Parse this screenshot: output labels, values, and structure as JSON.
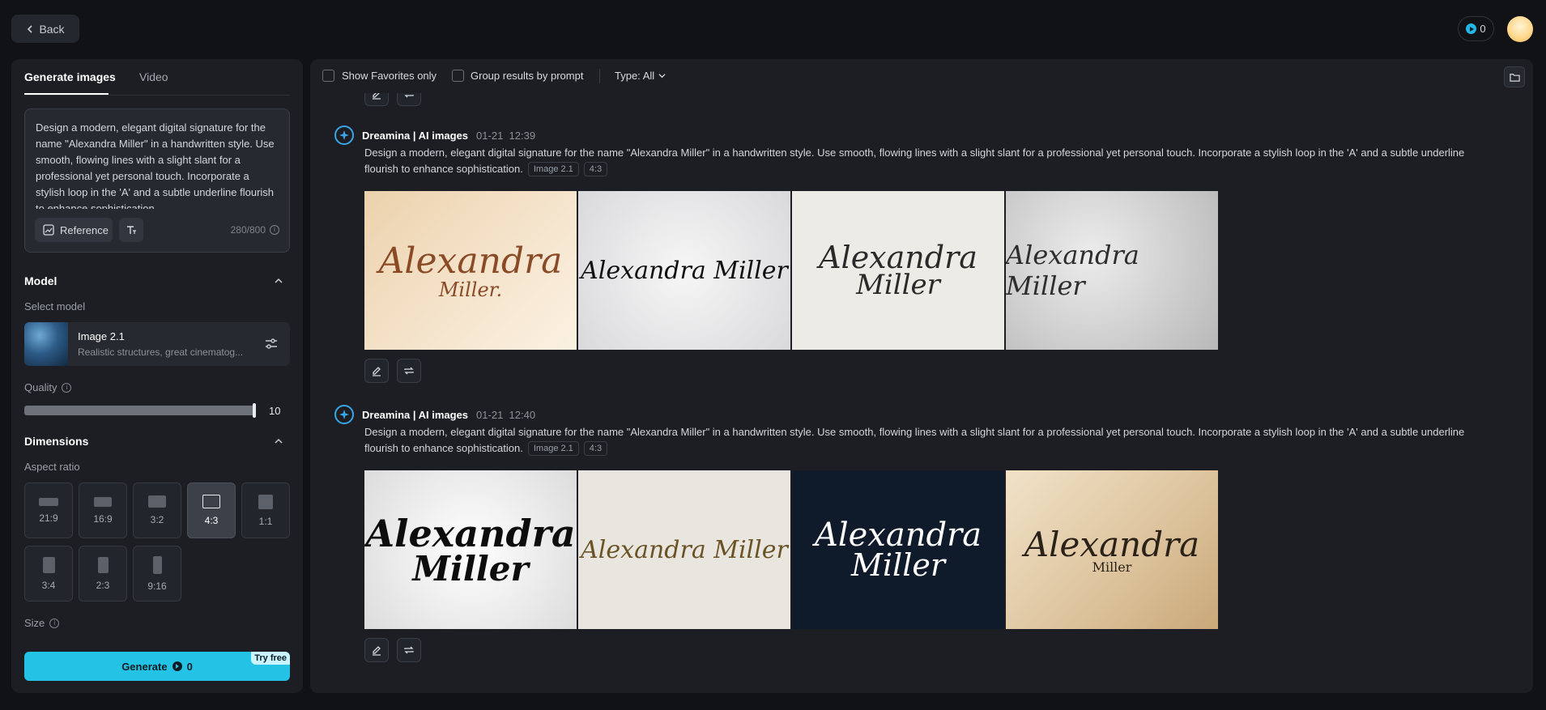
{
  "topbar": {
    "back_label": "Back",
    "credits": "0"
  },
  "left": {
    "tabs": [
      {
        "label": "Generate images"
      },
      {
        "label": "Video"
      }
    ],
    "prompt": "Design a modern, elegant digital signature for the name \"Alexandra Miller\" in a handwritten style. Use smooth, flowing lines with a slight slant for a professional yet personal touch. Incorporate a stylish loop in the 'A' and a subtle underline flourish to enhance sophistication.",
    "reference_label": "Reference",
    "char_count": "280/800",
    "model": {
      "title": "Model",
      "select_label": "Select model",
      "name": "Image 2.1",
      "description": "Realistic structures, great cinematog..."
    },
    "quality": {
      "label": "Quality",
      "value": "10",
      "level": 1.0
    },
    "dimensions": {
      "title": "Dimensions",
      "aspect_label": "Aspect ratio",
      "ratios": [
        "21:9",
        "16:9",
        "3:2",
        "4:3",
        "1:1",
        "3:4",
        "2:3",
        "9:16"
      ],
      "selected": "4:3"
    },
    "size_label": "Size",
    "generate": {
      "label": "Generate",
      "cost": "0",
      "badge": "Try free"
    }
  },
  "filters": {
    "favorites_label": "Show Favorites only",
    "group_label": "Group results by prompt",
    "type_label": "Type: All"
  },
  "groups": [
    {
      "source": "Dreamina | AI images",
      "date": "01-21",
      "time": "12:39",
      "prompt": "Design a modern, elegant digital signature for the name \"Alexandra Miller\" in a handwritten style. Use smooth, flowing lines with a slight slant for a professional yet personal touch. Incorporate a stylish loop in the 'A' and a subtle underline flourish to enhance sophistication.",
      "tags": [
        "Image 2.1",
        "4:3"
      ],
      "images": [
        {
          "line1": "Alexandra",
          "line2": "Miller.",
          "bg": "#f1dcc0",
          "ink": "#8a4a26"
        },
        {
          "line1": "Alexandra Miller",
          "line2": "",
          "bg": "#e6e6e8",
          "ink": "#111111"
        },
        {
          "line1": "Alexandra",
          "line2": "Miller",
          "bg": "#ecebe5",
          "ink": "#2a2a2a"
        },
        {
          "line1": "Alexandra Miller",
          "line2": "",
          "bg": "#c9c9c9",
          "ink": "#2e2e2e"
        }
      ]
    },
    {
      "source": "Dreamina | AI images",
      "date": "01-21",
      "time": "12:40",
      "prompt": "Design a modern, elegant digital signature for the name \"Alexandra Miller\" in a handwritten style. Use smooth, flowing lines with a slight slant for a professional yet personal touch. Incorporate a stylish loop in the 'A' and a subtle underline flourish to enhance sophistication.",
      "tags": [
        "Image 2.1",
        "4:3"
      ],
      "images": [
        {
          "line1": "Alexandra",
          "line2": "Miller",
          "bg": "#f2f2f2",
          "ink": "#0d0d0d"
        },
        {
          "line1": "Alexandra Miller",
          "line2": "",
          "bg": "#e9e6df",
          "ink": "#6b5326"
        },
        {
          "line1": "Alexandra",
          "line2": "Miller",
          "bg": "#0f1a2a",
          "ink": "#ffffff"
        },
        {
          "line1": "Alexandra",
          "line2": "Miller",
          "bg": "#dcc29b",
          "ink": "#2a2218"
        }
      ]
    }
  ]
}
